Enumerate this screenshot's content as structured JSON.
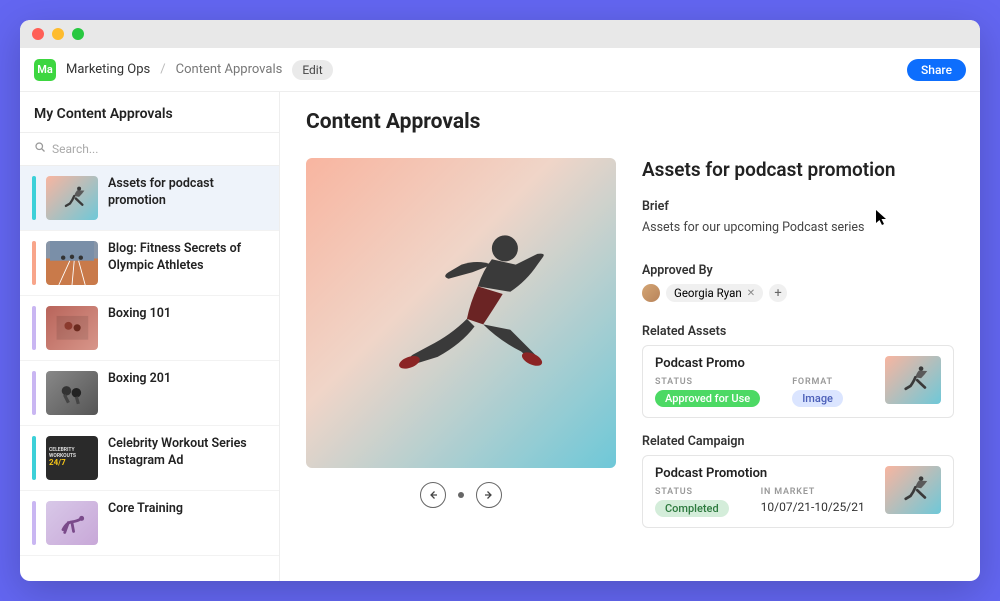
{
  "breadcrumb": {
    "workspace_abbr": "Ma",
    "workspace": "Marketing Ops",
    "page": "Content Approvals",
    "edit_label": "Edit"
  },
  "share_label": "Share",
  "sidebar": {
    "title": "My Content Approvals",
    "search_placeholder": "Search...",
    "items": [
      {
        "title": "Assets for podcast promotion",
        "accent": "#3dd0d8",
        "selected": true,
        "thumb": "runner"
      },
      {
        "title": "Blog: Fitness Secrets of Olympic Athletes",
        "accent": "#f8a58a",
        "selected": false,
        "thumb": "track"
      },
      {
        "title": "Boxing 101",
        "accent": "#c9b6f2",
        "selected": false,
        "thumb": "gym"
      },
      {
        "title": "Boxing 201",
        "accent": "#c9b6f2",
        "selected": false,
        "thumb": "boxing"
      },
      {
        "title": "Celebrity Workout Series Instagram Ad",
        "accent": "#3dd0d8",
        "selected": false,
        "thumb": "ad247"
      },
      {
        "title": "Core Training",
        "accent": "#c9b6f2",
        "selected": false,
        "thumb": "core"
      }
    ]
  },
  "main": {
    "heading": "Content Approvals",
    "record": {
      "title": "Assets for podcast promotion",
      "brief_label": "Brief",
      "brief_text": "Assets for our upcoming Podcast series",
      "approved_label": "Approved By",
      "approved_by": "Georgia Ryan",
      "related_assets_label": "Related Assets",
      "related_asset": {
        "title": "Podcast Promo",
        "status_label": "STATUS",
        "status": "Approved for Use",
        "format_label": "FORMAT",
        "format": "Image"
      },
      "related_campaign_label": "Related Campaign",
      "related_campaign": {
        "title": "Podcast Promotion",
        "status_label": "STATUS",
        "status": "Completed",
        "in_market_label": "IN MARKET",
        "in_market": "10/07/21-10/25/21"
      }
    }
  }
}
